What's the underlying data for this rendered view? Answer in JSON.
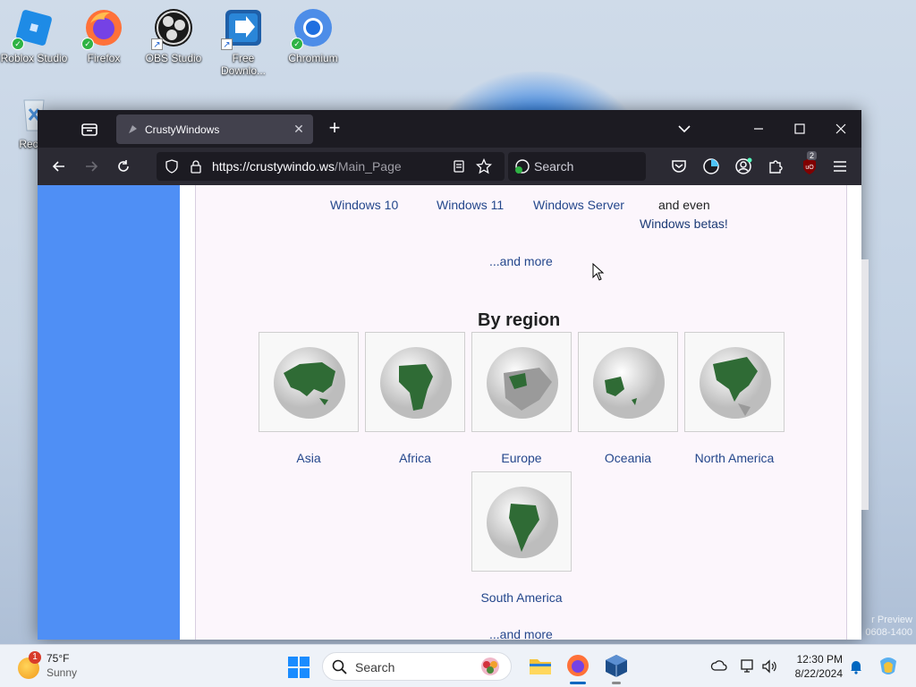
{
  "desktop": {
    "icons": [
      {
        "label": "Roblox Studio"
      },
      {
        "label": "Firefox"
      },
      {
        "label": "OBS Studio"
      },
      {
        "label": "Free Downlo..."
      },
      {
        "label": "Chromium"
      },
      {
        "label": "Recyc"
      }
    ],
    "watermark_line1": "r Preview",
    "watermark_line2": "0608-1400"
  },
  "browser": {
    "tab": {
      "title": "CrustyWindows"
    },
    "url": {
      "host": "https://crustywindo.ws",
      "path": "/Main_Page"
    },
    "search_placeholder": "Search",
    "extension_badge": "2"
  },
  "page": {
    "versions": [
      {
        "label": "Windows 10"
      },
      {
        "label": "Windows 11"
      },
      {
        "label": "Windows Server"
      }
    ],
    "and_even": "and even",
    "betas_link": "Windows betas!",
    "more_link_1": "...and more",
    "region_title": "By region",
    "regions": [
      {
        "label": "Asia"
      },
      {
        "label": "Africa"
      },
      {
        "label": "Europe"
      },
      {
        "label": "Oceania"
      },
      {
        "label": "North America"
      },
      {
        "label": "South America"
      }
    ],
    "more_link_2": "...and more"
  },
  "taskbar": {
    "weather": {
      "temp": "75°F",
      "condition": "Sunny",
      "badge": "1"
    },
    "search_placeholder": "Search",
    "time": "12:30 PM",
    "date": "8/22/2024"
  },
  "colors": {
    "link": "#24478c",
    "accent_blue": "#4f8ff5",
    "globe_land": "#2f6b35"
  }
}
